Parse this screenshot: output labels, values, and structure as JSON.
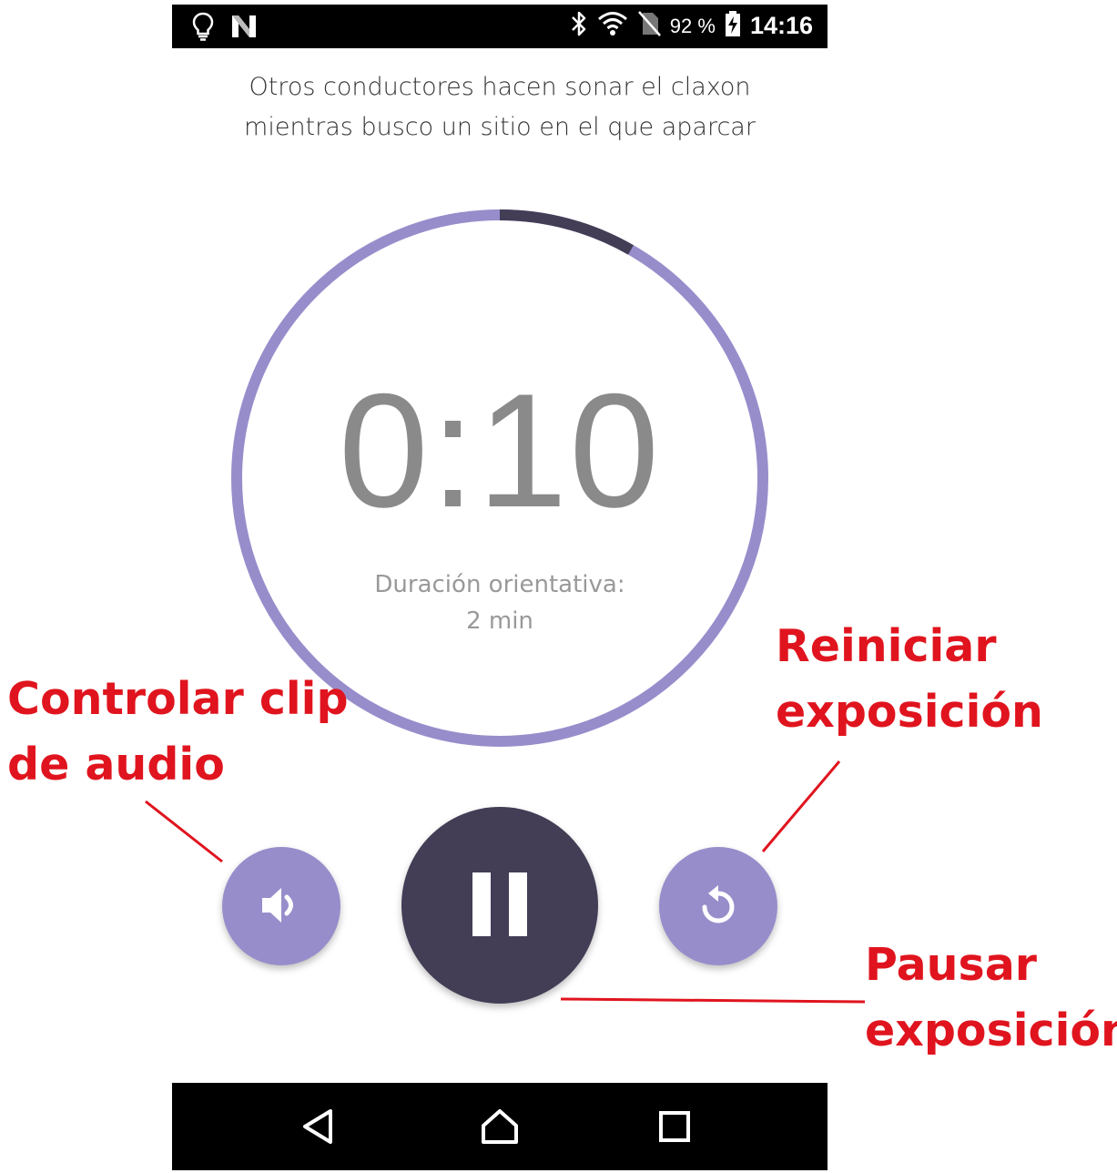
{
  "status_bar": {
    "battery_percent": "92 %",
    "time": "14:16",
    "icons": [
      "lightbulb-icon",
      "n-logo-icon",
      "bluetooth-icon",
      "wifi-icon",
      "no-sim-icon",
      "battery-charging-icon"
    ]
  },
  "prompt": {
    "line1": "Otros conductores hacen sonar el claxon",
    "line2": "mientras busco un sitio en el que aparcar"
  },
  "timer": {
    "value": "0:10",
    "progress_fraction": 0.083,
    "duration_label": "Duración orientativa:",
    "duration_value": "2 min"
  },
  "controls": {
    "audio_icon": "volume-icon",
    "pause_icon": "pause-icon",
    "restart_icon": "restart-icon"
  },
  "nav_bar": {
    "icons": [
      "back-icon",
      "home-icon",
      "recent-apps-icon"
    ]
  },
  "annotations": {
    "audio": [
      "Controlar clip",
      "de audio"
    ],
    "restart": [
      "Reiniciar",
      "exposición"
    ],
    "pause": [
      "Pausar",
      "exposición"
    ]
  },
  "colors": {
    "ring": "#988dcb",
    "ring_progress": "#433d56",
    "pause_button": "#433d56",
    "secondary_button": "#988dcb",
    "annotation": "#e0141e"
  }
}
